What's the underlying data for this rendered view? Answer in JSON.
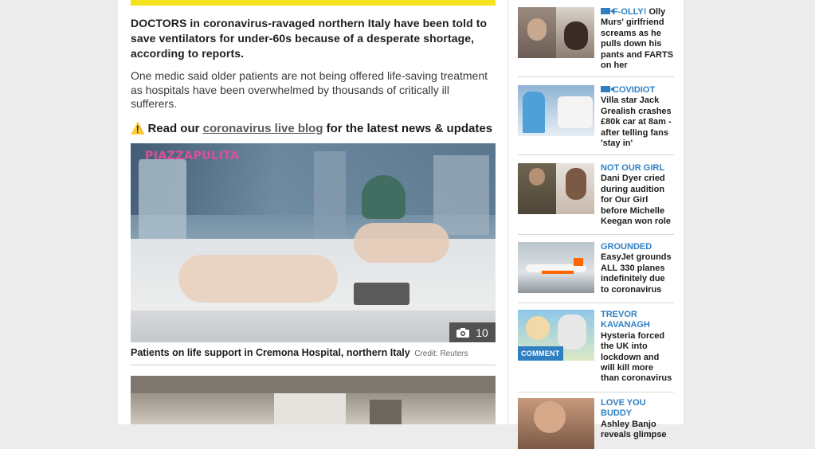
{
  "article": {
    "lead": "DOCTORS in coronavirus-ravaged northern Italy have been told to save ventilators for under-60s because of a desperate shortage, according to reports.",
    "paragraph": "One medic said older patients are not being offered life-saving treatment as hospitals have been overwhelmed by thousands of critically ill sufferers.",
    "liveblog_warning_icon": "warning-icon",
    "liveblog_prefix": "Read our",
    "liveblog_link": "coronavirus live blog",
    "liveblog_suffix": "for the latest news & updates",
    "photo_watermark": "PIAZZAPULITA",
    "photo_count": "10",
    "caption": "Patients on life support in Cremona Hospital, northern Italy",
    "credit": "Credit: Reuters"
  },
  "sidebar": {
    "stories": [
      {
        "kicker": "F-OLLY!",
        "headline": "Olly Murs' girlfriend screams as he pulls down his pants and FARTS on her",
        "video": true
      },
      {
        "kicker": "COVIDIOT",
        "headline": "Villa star Jack Grealish crashes £80k car at 8am - after telling fans 'stay in'",
        "video": true
      },
      {
        "kicker": "NOT OUR GIRL",
        "headline": "Dani Dyer cried during audition for Our Girl before Michelle Keegan won role",
        "video": false
      },
      {
        "kicker": "GROUNDED",
        "headline": "EasyJet grounds ALL 330 planes indefinitely due to coronavirus",
        "video": false
      },
      {
        "kicker": "TREVOR KAVANAGH",
        "headline": "Hysteria forced the UK into lockdown and will kill more than coronavirus",
        "video": false,
        "tag": "COMMENT"
      },
      {
        "kicker": "LOVE YOU BUDDY",
        "headline": "Ashley Banjo reveals glimpse",
        "video": false
      }
    ]
  },
  "colors": {
    "accent_blue": "#2f7fc2",
    "yellow": "#f6e11d",
    "background": "#ececec"
  }
}
